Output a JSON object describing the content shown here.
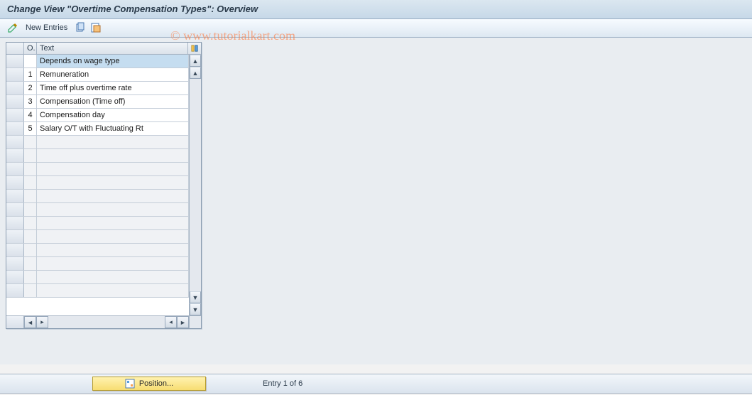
{
  "title": "Change View \"Overtime Compensation Types\": Overview",
  "toolbar": {
    "new_entries_label": "New Entries"
  },
  "table": {
    "headers": {
      "o": "O.",
      "text": "Text"
    },
    "rows": [
      {
        "code": "",
        "text": "Depends on wage type",
        "highlight": true
      },
      {
        "code": "1",
        "text": "Remuneration"
      },
      {
        "code": "2",
        "text": "Time off plus overtime rate"
      },
      {
        "code": "3",
        "text": "Compensation (Time off)"
      },
      {
        "code": "4",
        "text": "Compensation day"
      },
      {
        "code": "5",
        "text": "Salary O/T with Fluctuating Rt"
      }
    ],
    "empty_rows": 12
  },
  "footer": {
    "position_label": "Position...",
    "entry_label": "Entry 1 of 6"
  },
  "watermark": "© www.tutorialkart.com"
}
